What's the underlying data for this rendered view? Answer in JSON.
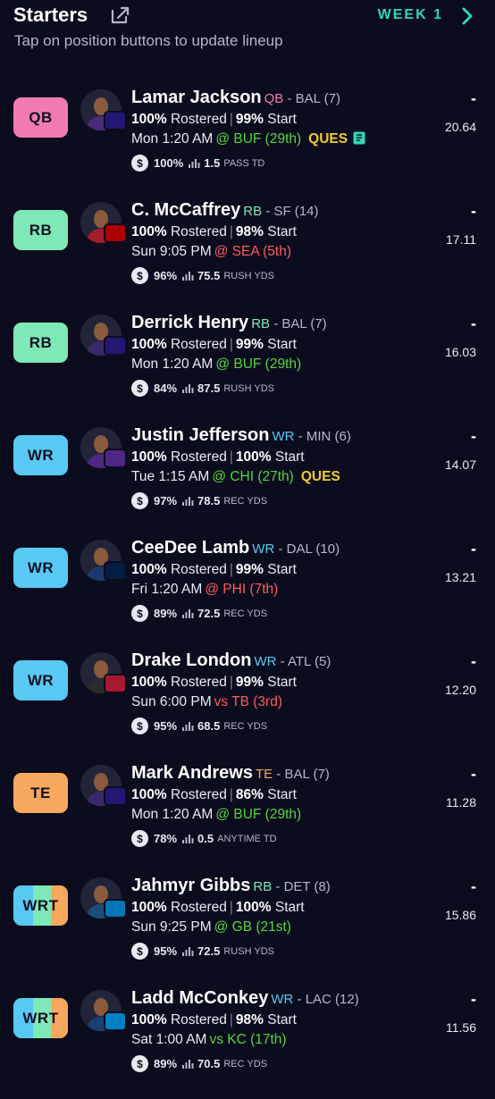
{
  "header": {
    "title": "Starters",
    "week_label": "WEEK 1",
    "subtitle": "Tap on position buttons to update lineup",
    "icons": [
      "share-icon",
      "chevron-right-icon"
    ]
  },
  "colors": {
    "accent": "#31d6b3",
    "pos_qb": "#f17bb0",
    "pos_rb": "#7ee8b6",
    "pos_wr": "#59c8f4",
    "pos_te": "#f8a85c",
    "opp_good": "#58d43c",
    "opp_bad": "#ff5a5f",
    "ques": "#f2cb2c"
  },
  "rostered_label": "Rostered",
  "start_label": "Start",
  "players": [
    {
      "slot": "QB",
      "name": "Lamar Jackson",
      "pos": "QB",
      "team": "BAL (7)",
      "rostered": "100%",
      "start": "99%",
      "time": "Mon 1:20 AM",
      "opp": "@ BUF (29th)",
      "opp_quality": "good",
      "status": "QUES",
      "news": true,
      "dollar_pct": "100%",
      "proj": "1.5",
      "stat": "PASS TD",
      "score": "-",
      "points": "20.64"
    },
    {
      "slot": "RB",
      "name": "C. McCaffrey",
      "pos": "RB",
      "team": "SF (14)",
      "rostered": "100%",
      "start": "98%",
      "time": "Sun 9:05 PM",
      "opp": "@ SEA (5th)",
      "opp_quality": "bad",
      "status": "",
      "news": false,
      "dollar_pct": "96%",
      "proj": "75.5",
      "stat": "RUSH YDS",
      "score": "-",
      "points": "17.11"
    },
    {
      "slot": "RB",
      "name": "Derrick Henry",
      "pos": "RB",
      "team": "BAL (7)",
      "rostered": "100%",
      "start": "99%",
      "time": "Mon 1:20 AM",
      "opp": "@ BUF (29th)",
      "opp_quality": "good",
      "status": "",
      "news": false,
      "dollar_pct": "84%",
      "proj": "87.5",
      "stat": "RUSH YDS",
      "score": "-",
      "points": "16.03"
    },
    {
      "slot": "WR",
      "name": "Justin Jefferson",
      "pos": "WR",
      "team": "MIN (6)",
      "rostered": "100%",
      "start": "100%",
      "time": "Tue 1:15 AM",
      "opp": "@ CHI (27th)",
      "opp_quality": "good",
      "status": "QUES",
      "news": false,
      "dollar_pct": "97%",
      "proj": "78.5",
      "stat": "REC YDS",
      "score": "-",
      "points": "14.07"
    },
    {
      "slot": "WR",
      "name": "CeeDee Lamb",
      "pos": "WR",
      "team": "DAL (10)",
      "rostered": "100%",
      "start": "99%",
      "time": "Fri 1:20 AM",
      "opp": "@ PHI (7th)",
      "opp_quality": "bad",
      "status": "",
      "news": false,
      "dollar_pct": "89%",
      "proj": "72.5",
      "stat": "REC YDS",
      "score": "-",
      "points": "13.21"
    },
    {
      "slot": "WR",
      "name": "Drake London",
      "pos": "WR",
      "team": "ATL (5)",
      "rostered": "100%",
      "start": "99%",
      "time": "Sun 6:00 PM",
      "opp": "vs TB (3rd)",
      "opp_quality": "bad",
      "status": "",
      "news": false,
      "dollar_pct": "95%",
      "proj": "68.5",
      "stat": "REC YDS",
      "score": "-",
      "points": "12.20"
    },
    {
      "slot": "TE",
      "name": "Mark Andrews",
      "pos": "TE",
      "team": "BAL (7)",
      "rostered": "100%",
      "start": "86%",
      "time": "Mon 1:20 AM",
      "opp": "@ BUF (29th)",
      "opp_quality": "good",
      "status": "",
      "news": false,
      "dollar_pct": "78%",
      "proj": "0.5",
      "stat": "ANYTIME TD",
      "score": "-",
      "points": "11.28"
    },
    {
      "slot": "WRT",
      "name": "Jahmyr Gibbs",
      "pos": "RB",
      "team": "DET (8)",
      "rostered": "100%",
      "start": "100%",
      "time": "Sun 9:25 PM",
      "opp": "@ GB (21st)",
      "opp_quality": "good",
      "status": "",
      "news": false,
      "dollar_pct": "95%",
      "proj": "72.5",
      "stat": "RUSH YDS",
      "score": "-",
      "points": "15.86"
    },
    {
      "slot": "WRT",
      "name": "Ladd McConkey",
      "pos": "WR",
      "team": "LAC (12)",
      "rostered": "100%",
      "start": "98%",
      "time": "Sat 1:00 AM",
      "opp": "vs KC (17th)",
      "opp_quality": "good",
      "status": "",
      "news": false,
      "dollar_pct": "89%",
      "proj": "70.5",
      "stat": "REC YDS",
      "score": "-",
      "points": "11.56"
    }
  ]
}
